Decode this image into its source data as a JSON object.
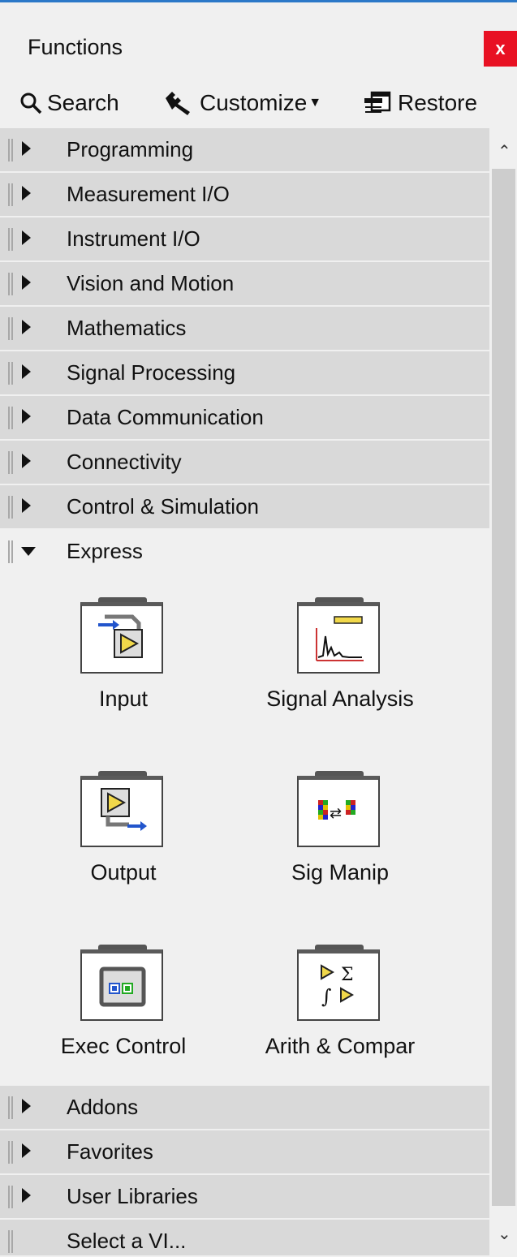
{
  "window": {
    "title": "Functions",
    "close_label": "x"
  },
  "toolbar": {
    "search_label": "Search",
    "customize_label": "Customize",
    "restore_label": "Restore"
  },
  "categories_top": [
    {
      "label": "Programming"
    },
    {
      "label": "Measurement I/O"
    },
    {
      "label": "Instrument I/O"
    },
    {
      "label": "Vision and Motion"
    },
    {
      "label": "Mathematics"
    },
    {
      "label": "Signal Processing"
    },
    {
      "label": "Data Communication"
    },
    {
      "label": "Connectivity"
    },
    {
      "label": "Control & Simulation"
    }
  ],
  "express": {
    "label": "Express",
    "items": [
      {
        "label": "Input",
        "icon": "input-icon"
      },
      {
        "label": "Signal Analysis",
        "icon": "signal-analysis-icon"
      },
      {
        "label": "Output",
        "icon": "output-icon"
      },
      {
        "label": "Sig Manip",
        "icon": "sig-manip-icon"
      },
      {
        "label": "Exec Control",
        "icon": "exec-control-icon"
      },
      {
        "label": "Arith & Compar",
        "icon": "arith-compar-icon"
      }
    ]
  },
  "categories_bottom": [
    {
      "label": "Addons"
    },
    {
      "label": "Favorites"
    },
    {
      "label": "User Libraries"
    },
    {
      "label": "Select a VI..."
    }
  ],
  "colors": {
    "close_red": "#e81123",
    "category_bg": "#d9d9d9",
    "accent_blue": "#2b78c8"
  }
}
